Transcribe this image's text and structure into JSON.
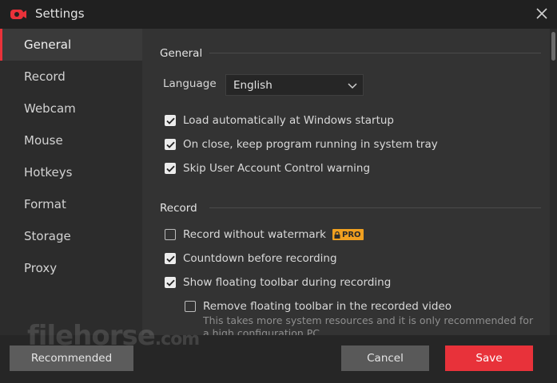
{
  "window": {
    "title": "Settings"
  },
  "sidebar": {
    "items": [
      {
        "label": "General",
        "active": true
      },
      {
        "label": "Record"
      },
      {
        "label": "Webcam"
      },
      {
        "label": "Mouse"
      },
      {
        "label": "Hotkeys"
      },
      {
        "label": "Format"
      },
      {
        "label": "Storage"
      },
      {
        "label": "Proxy"
      }
    ]
  },
  "general": {
    "heading": "General",
    "language_label": "Language",
    "language_value": "English",
    "options": [
      {
        "label": "Load automatically at Windows startup",
        "checked": true
      },
      {
        "label": "On close, keep program running in system tray",
        "checked": true
      },
      {
        "label": "Skip User Account Control warning",
        "checked": true
      }
    ]
  },
  "record": {
    "heading": "Record",
    "options": [
      {
        "label": "Record without watermark",
        "checked": false,
        "badge": "PRO"
      },
      {
        "label": "Countdown before recording",
        "checked": true
      },
      {
        "label": "Show floating toolbar during recording",
        "checked": true
      },
      {
        "label": "Remove floating toolbar in the recorded video",
        "checked": false
      }
    ],
    "note": "This takes more system resources and it is only recommended for a high configuration PC."
  },
  "footer": {
    "recommended_label": "Recommended",
    "cancel_label": "Cancel",
    "save_label": "Save"
  },
  "watermark": {
    "text": "filehorse",
    "suffix": ".com"
  },
  "colors": {
    "accent": "#e8323a",
    "pro_badge": "#f0a020",
    "background": "#333333"
  }
}
